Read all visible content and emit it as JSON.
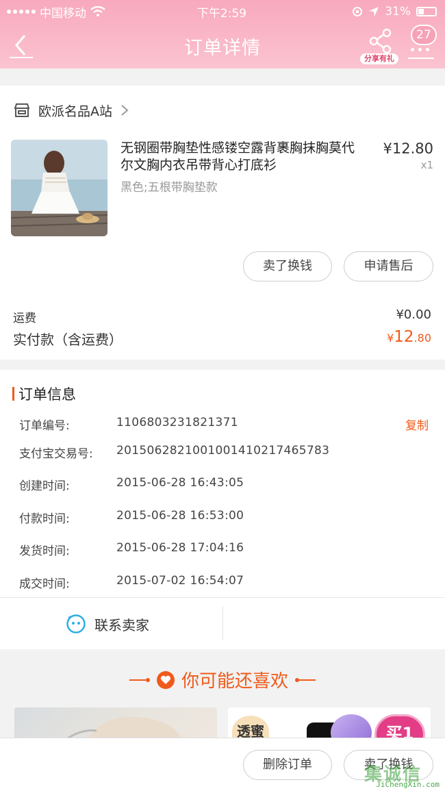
{
  "status_bar": {
    "carrier": "中国移动",
    "time": "下午2:59",
    "battery": "31%"
  },
  "nav": {
    "title": "订单详情",
    "share_label": "分享有礼",
    "badge_count": "27"
  },
  "shop": {
    "name": "欧派名品A站"
  },
  "product": {
    "title": "无钢圈带胸垫性感镂空露背裹胸抹胸莫代尔文胸内衣吊带背心打底衫",
    "spec": "黑色;五根带胸垫款",
    "price": "¥12.80",
    "qty": "x1",
    "buttons": {
      "sell": "卖了换钱",
      "after_sale": "申请售后"
    }
  },
  "fees": {
    "shipping_label": "运费",
    "shipping_value": "¥0.00",
    "paid_label": "实付款（含运费）",
    "paid_currency": "¥",
    "paid_int": "12",
    "paid_dec": ".80"
  },
  "order_info": {
    "title": "订单信息",
    "copy": "复制",
    "rows": [
      {
        "label": "订单编号:",
        "value": "1106803231821371"
      },
      {
        "label": "支付宝交易号:",
        "value": "2015062821001001410217465783"
      },
      {
        "label": "创建时间:",
        "value": "2015-06-28 16:43:05"
      },
      {
        "label": "付款时间:",
        "value": "2015-06-28 16:53:00"
      },
      {
        "label": "发货时间:",
        "value": "2015-06-28 17:04:16"
      },
      {
        "label": "成交时间:",
        "value": "2015-07-02 16:54:07"
      }
    ]
  },
  "contact": {
    "label": "联系卖家"
  },
  "recommend": {
    "title": "你可能还喜欢",
    "tag_left": "透蜜",
    "tag_right": "买1"
  },
  "bottom": {
    "delete": "删除订单",
    "sell": "卖了换钱"
  },
  "watermark": {
    "chars": "集诚信",
    "url": "JiChengXin.com"
  }
}
